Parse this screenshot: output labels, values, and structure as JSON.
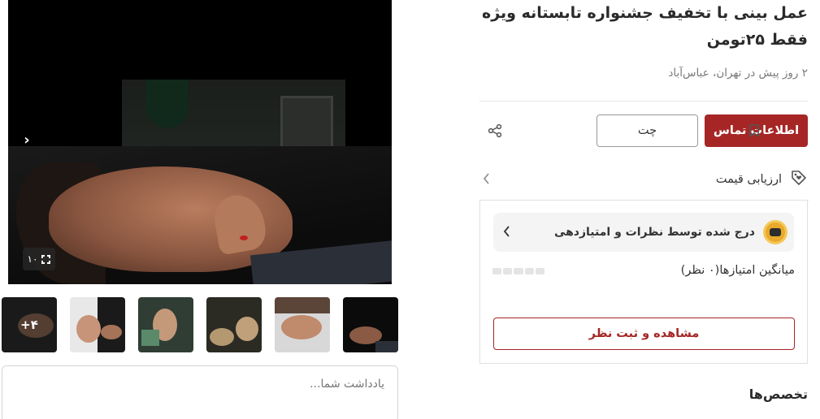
{
  "gallery": {
    "image_count_badge": "۱۰",
    "more_thumbs_label": "+۴",
    "note_placeholder": "یادداشت شما..."
  },
  "listing": {
    "title": "عمل بینی با تخفیف جشنواره تابستانه ویژه فقط ۲۵تومن",
    "meta": "۲ روز پیش در تهران، عباس‌آباد"
  },
  "actions": {
    "contact_label": "اطلاعات تماس",
    "chat_label": "چت"
  },
  "price_evaluation": {
    "label": "ارزیابی قیمت"
  },
  "reviews": {
    "banner_text": "درج شده توسط نظرات و امتیازدهی",
    "average_label": "میانگین امتیازها(۰ نظر)",
    "rating_segments": 5,
    "view_button_label": "مشاهده و ثبت نظر"
  },
  "sections": {
    "specialties_title": "تخصص‌ها"
  },
  "colors": {
    "primary": "#a62626",
    "muted_text": "#7a7a7a"
  }
}
